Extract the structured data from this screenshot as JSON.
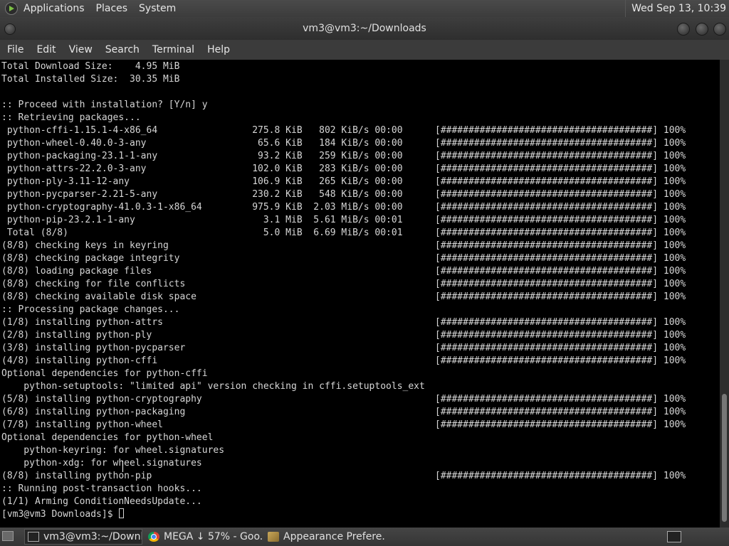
{
  "top_panel": {
    "menus": [
      "Applications",
      "Places",
      "System"
    ],
    "clock": "Wed Sep 13, 10:39"
  },
  "window": {
    "title": "vm3@vm3:~/Downloads",
    "menu": [
      "File",
      "Edit",
      "View",
      "Search",
      "Terminal",
      "Help"
    ]
  },
  "terminal": {
    "lines": [
      {
        "text": "Total Download Size:    4.95 MiB",
        "bar": ""
      },
      {
        "text": "Total Installed Size:  30.35 MiB",
        "bar": ""
      },
      {
        "text": "",
        "bar": ""
      },
      {
        "text": ":: Proceed with installation? [Y/n] y",
        "bar": ""
      },
      {
        "text": ":: Retrieving packages...",
        "bar": ""
      },
      {
        "text": " python-cffi-1.15.1-4-x86_64                 275.8 KiB   802 KiB/s 00:00",
        "bar": "[######################################] 100%"
      },
      {
        "text": " python-wheel-0.40.0-3-any                    65.6 KiB   184 KiB/s 00:00",
        "bar": "[######################################] 100%"
      },
      {
        "text": " python-packaging-23.1-1-any                  93.2 KiB   259 KiB/s 00:00",
        "bar": "[######################################] 100%"
      },
      {
        "text": " python-attrs-22.2.0-3-any                   102.0 KiB   283 KiB/s 00:00",
        "bar": "[######################################] 100%"
      },
      {
        "text": " python-ply-3.11-12-any                      106.9 KiB   265 KiB/s 00:00",
        "bar": "[######################################] 100%"
      },
      {
        "text": " python-pycparser-2.21-5-any                 230.2 KiB   548 KiB/s 00:00",
        "bar": "[######################################] 100%"
      },
      {
        "text": " python-cryptography-41.0.3-1-x86_64         975.9 KiB  2.03 MiB/s 00:00",
        "bar": "[######################################] 100%"
      },
      {
        "text": " python-pip-23.2.1-1-any                       3.1 MiB  5.61 MiB/s 00:01",
        "bar": "[######################################] 100%"
      },
      {
        "text": " Total (8/8)                                   5.0 MiB  6.69 MiB/s 00:01",
        "bar": "[######################################] 100%"
      },
      {
        "text": "(8/8) checking keys in keyring",
        "bar": "[######################################] 100%"
      },
      {
        "text": "(8/8) checking package integrity",
        "bar": "[######################################] 100%"
      },
      {
        "text": "(8/8) loading package files",
        "bar": "[######################################] 100%"
      },
      {
        "text": "(8/8) checking for file conflicts",
        "bar": "[######################################] 100%"
      },
      {
        "text": "(8/8) checking available disk space",
        "bar": "[######################################] 100%"
      },
      {
        "text": ":: Processing package changes...",
        "bar": ""
      },
      {
        "text": "(1/8) installing python-attrs",
        "bar": "[######################################] 100%"
      },
      {
        "text": "(2/8) installing python-ply",
        "bar": "[######################################] 100%"
      },
      {
        "text": "(3/8) installing python-pycparser",
        "bar": "[######################################] 100%"
      },
      {
        "text": "(4/8) installing python-cffi",
        "bar": "[######################################] 100%"
      },
      {
        "text": "Optional dependencies for python-cffi",
        "bar": ""
      },
      {
        "text": "    python-setuptools: \"limited api\" version checking in cffi.setuptools_ext",
        "bar": ""
      },
      {
        "text": "(5/8) installing python-cryptography",
        "bar": "[######################################] 100%"
      },
      {
        "text": "(6/8) installing python-packaging",
        "bar": "[######################################] 100%"
      },
      {
        "text": "(7/8) installing python-wheel",
        "bar": "[######################################] 100%"
      },
      {
        "text": "Optional dependencies for python-wheel",
        "bar": ""
      },
      {
        "text": "    python-keyring: for wheel.signatures",
        "bar": ""
      },
      {
        "text": "    python-xdg: for wheel.signatures",
        "bar": ""
      },
      {
        "text": "(8/8) installing python-pip",
        "bar": "[######################################] 100%"
      },
      {
        "text": ":: Running post-transaction hooks...",
        "bar": ""
      },
      {
        "text": "(1/1) Arming ConditionNeedsUpdate...",
        "bar": ""
      }
    ],
    "prompt": "[vm3@vm3 Downloads]$ "
  },
  "taskbar": {
    "tasks": [
      "vm3@vm3:~/Downl...",
      "MEGA ↓ 57% - Goo...",
      "Appearance Prefere..."
    ]
  },
  "icons": {
    "applications": "distro-logo-icon",
    "terminal": "terminal-icon",
    "browser": "chrome-icon",
    "appearance": "appearance-preferences-icon"
  }
}
